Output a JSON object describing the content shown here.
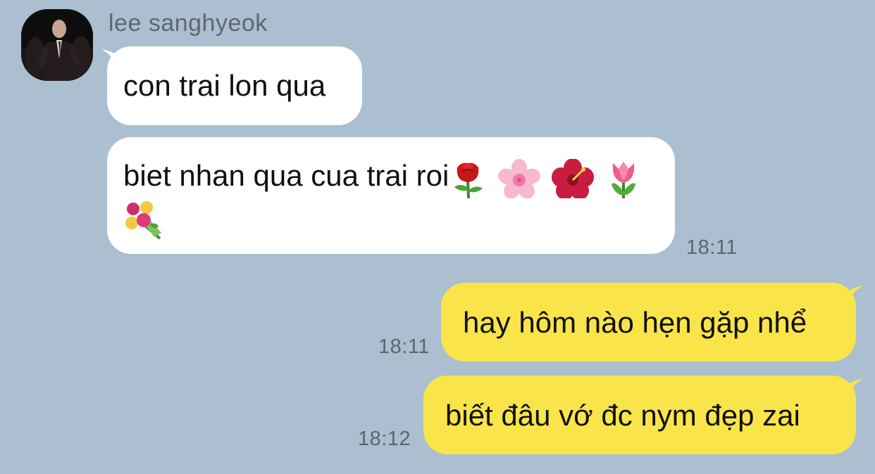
{
  "sender": {
    "name": "lee sanghyeok",
    "avatar_icon": "profile-photo-man-in-dark-suit"
  },
  "messages": [
    {
      "direction": "incoming",
      "text": "con trai lon qua",
      "time": ""
    },
    {
      "direction": "incoming",
      "text": "biet nhan qua cua trai roi",
      "emojis": [
        "rose",
        "cherry-blossom",
        "hibiscus",
        "tulip",
        "bouquet"
      ],
      "time": "18:11"
    },
    {
      "direction": "outgoing",
      "text": "hay hôm nào hẹn gặp nhể",
      "time": "18:11"
    },
    {
      "direction": "outgoing",
      "text": "biết đâu vớ đc nym đẹp zai",
      "time": "18:12"
    }
  ],
  "colors": {
    "background": "#abbfd0",
    "incoming_bubble": "#ffffff",
    "outgoing_bubble": "#f9e44a",
    "timestamp": "#5c6670",
    "sender_name": "#5e6770"
  }
}
